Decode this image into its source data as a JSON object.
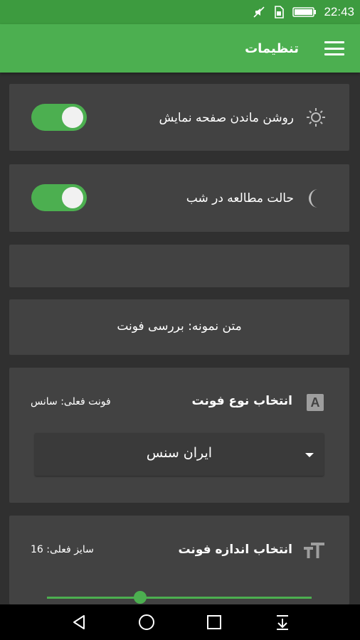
{
  "status_bar": {
    "time": "22:43"
  },
  "app_bar": {
    "title": "تنظیمات"
  },
  "settings": {
    "keep_screen_on": {
      "label": "روشن ماندن صفحه نمایش",
      "enabled": true
    },
    "night_mode": {
      "label": "حالت مطالعه در شب",
      "enabled": true
    },
    "sample_text": "متن نمونه: بررسی فونت",
    "font_type": {
      "title": "انتخاب نوع فونت",
      "current": "فونت فعلی: سانس",
      "selected_option": "ایران سنس"
    },
    "font_size": {
      "title": "انتخاب اندازه فونت",
      "current": "سایز فعلی: 16",
      "value": 16
    }
  },
  "colors": {
    "primary": "#4caf50",
    "status_bar": "#3d9b3f",
    "background": "#303030",
    "card": "#424242"
  }
}
